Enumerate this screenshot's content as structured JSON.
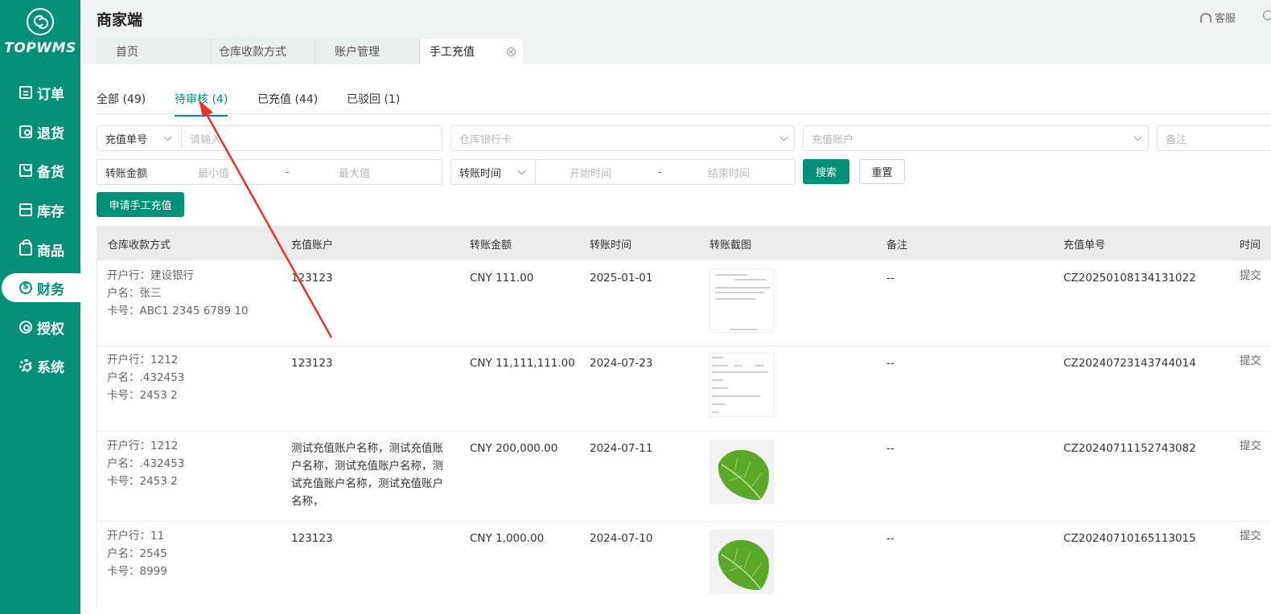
{
  "sidebar": {
    "logo_text": "TOPWMS",
    "items": [
      {
        "label": "订单",
        "icon": "order-icon"
      },
      {
        "label": "退货",
        "icon": "return-icon"
      },
      {
        "label": "备货",
        "icon": "stock-prep-icon"
      },
      {
        "label": "库存",
        "icon": "inventory-icon"
      },
      {
        "label": "商品",
        "icon": "goods-icon"
      },
      {
        "label": "财务",
        "icon": "finance-icon",
        "active": true
      },
      {
        "label": "授权",
        "icon": "authorize-icon"
      },
      {
        "label": "系统",
        "icon": "settings-icon"
      }
    ]
  },
  "header": {
    "title": "商家端",
    "service_label": "客服",
    "tabs": [
      {
        "label": "首页"
      },
      {
        "label": "仓库收款方式"
      },
      {
        "label": "账户管理"
      },
      {
        "label": "手工充值",
        "active": true
      }
    ]
  },
  "status_tabs": [
    {
      "label": "全部 (49)"
    },
    {
      "label": "待审核 (4)",
      "active": true
    },
    {
      "label": "已充值 (44)"
    },
    {
      "label": "已驳回 (1)"
    }
  ],
  "filters": {
    "type_select": "充值单号",
    "type_input_placeholder": "请输入",
    "bank_card_placeholder": "仓库银行卡",
    "account_placeholder": "充值账户",
    "remark_placeholder": "备注",
    "amount_label": "转账金额",
    "min_placeholder": "最小值",
    "max_placeholder": "最大值",
    "range_sep": "-",
    "time_select": "转账时间",
    "start_placeholder": "开始时间",
    "end_placeholder": "结束时间",
    "search_label": "搜索",
    "reset_label": "重置"
  },
  "apply_button": "申请手工充值",
  "table": {
    "columns": [
      "仓库收款方式",
      "充值账户",
      "转账金额",
      "转账时间",
      "转账截图",
      "备注",
      "充值单号",
      "时间"
    ],
    "rows": [
      {
        "bank": "开户行：建设银行",
        "name": "户名：张三",
        "card": "卡号：ABC1 2345 6789 10",
        "account": "123123",
        "amount": "CNY 111.00",
        "date": "2025-01-01",
        "shot": "document-screenshot",
        "remark": "--",
        "order_no": "CZ20250108134131022",
        "time": "提交"
      },
      {
        "bank": "开户行：1212",
        "name": "户名：.432453",
        "card": "卡号：2453 2",
        "account": "123123",
        "amount": "CNY 11,111,111.00",
        "date": "2024-07-23",
        "shot": "form-screenshot",
        "remark": "--",
        "order_no": "CZ20240723143744014",
        "time": "提交"
      },
      {
        "bank": "开户行：1212",
        "name": "户名：.432453",
        "card": "卡号：2453 2",
        "account": "测试充值账户名称，测试充值账户名称，测试充值账户名称，测试充值账户名称，测试充值账户名称，",
        "amount": "CNY 200,000.00",
        "date": "2024-07-11",
        "shot": "leaf-image",
        "remark": "--",
        "order_no": "CZ20240711152743082",
        "time": "提交"
      },
      {
        "bank": "开户行：11",
        "name": "户名：2545",
        "card": "卡号：8999",
        "account": "123123",
        "amount": "CNY 1,000.00",
        "date": "2024-07-10",
        "shot": "leaf-image",
        "remark": "--",
        "order_no": "CZ20240710165113015",
        "time": "提交"
      }
    ]
  },
  "colors": {
    "primary": "#009077",
    "annotation_arrow": "#e8322b"
  }
}
